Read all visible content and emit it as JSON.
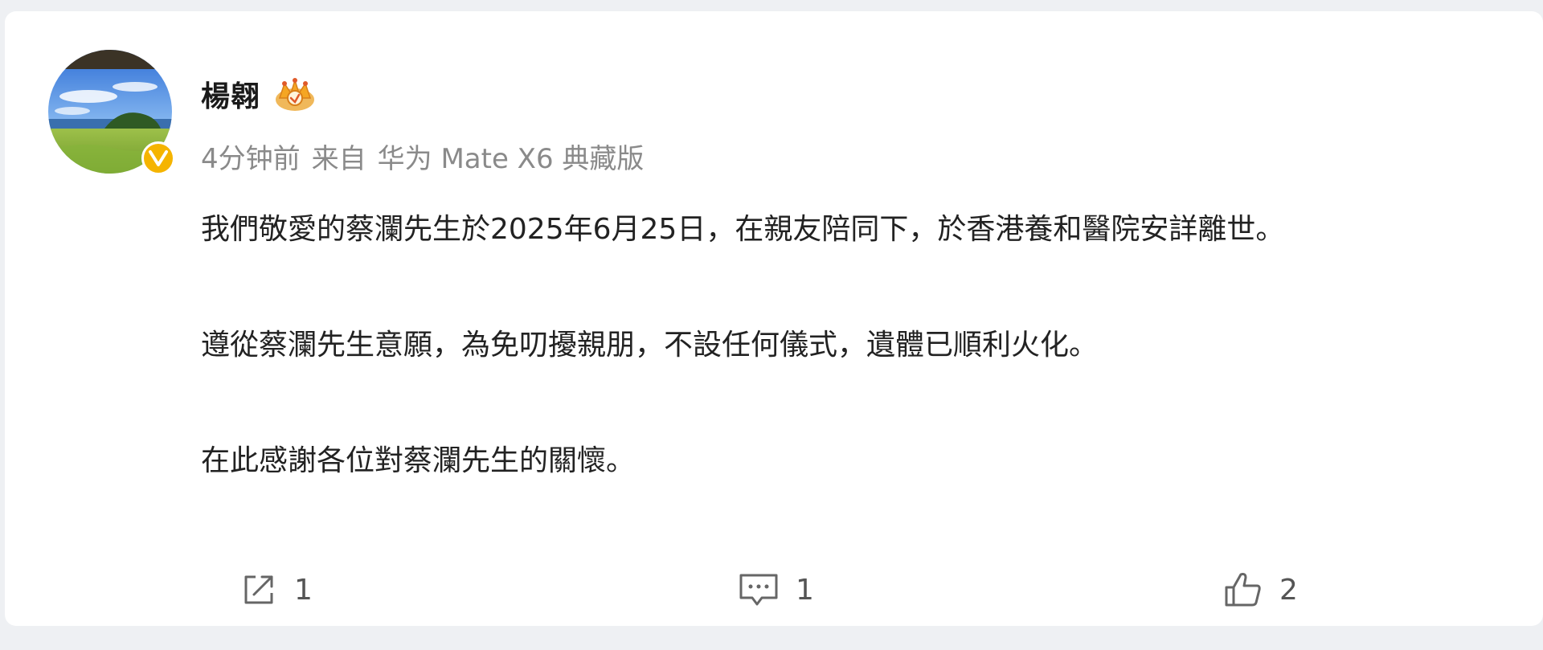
{
  "post": {
    "author": {
      "name": "楊翱",
      "avatar_icon": "landscape-avatar",
      "verified_badge": "V",
      "verified_color": "#f5b400",
      "member_badge_icon": "crown-badge-icon"
    },
    "meta": {
      "time": "4分钟前",
      "source_prefix": "来自",
      "source_device": "华为 Mate X6 典藏版"
    },
    "content": {
      "paragraphs": [
        "我們敬愛的蔡瀾先生於2025年6月25日，在親友陪同下，於香港養和醫院安詳離世。",
        "遵從蔡瀾先生意願，為免叨擾親朋，不設任何儀式，遺體已順利火化。",
        "在此感謝各位對蔡瀾先生的關懷。"
      ]
    },
    "actions": {
      "repost": {
        "icon": "share-icon",
        "count": "1"
      },
      "comment": {
        "icon": "comment-icon",
        "count": "1"
      },
      "like": {
        "icon": "thumbs-up-icon",
        "count": "2"
      }
    }
  }
}
